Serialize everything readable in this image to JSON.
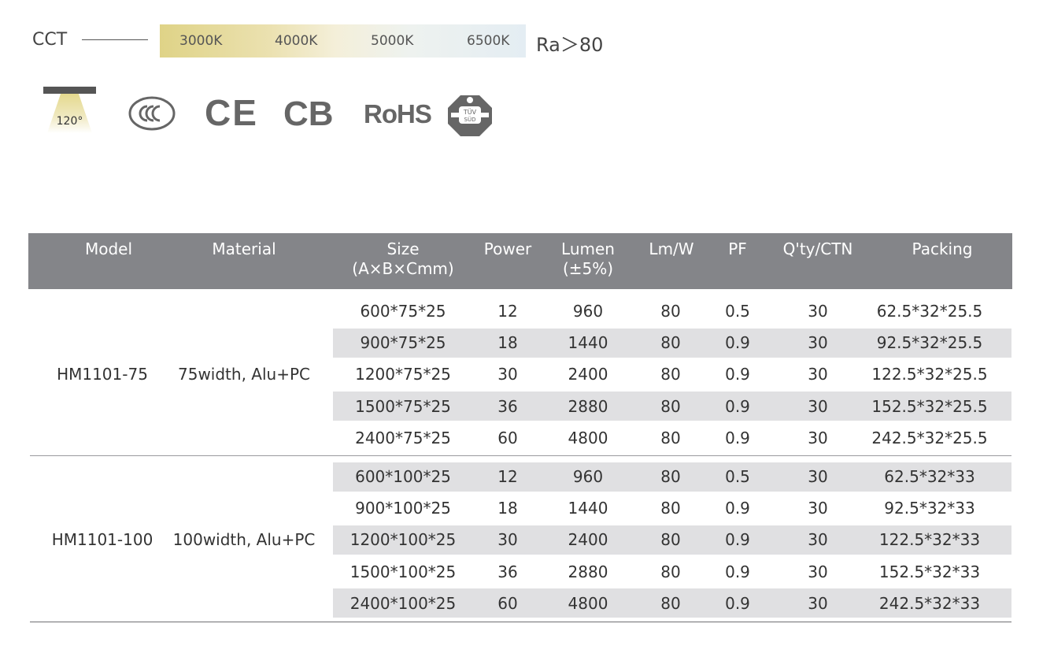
{
  "cct": {
    "label": "CCT",
    "temps": [
      "3000K",
      "4000K",
      "5000K",
      "6500K"
    ],
    "ra": "Ra＞80"
  },
  "icons": {
    "beam_angle": "120°",
    "ce": "CE",
    "cb": "CB",
    "rohs": "RoHS",
    "ccc": "CCC",
    "tuv": "TÜV SÜD"
  },
  "table": {
    "headers": [
      {
        "line1": "Model",
        "line2": ""
      },
      {
        "line1": "Material",
        "line2": ""
      },
      {
        "line1": "Size",
        "line2": "(A×B×Cmm)"
      },
      {
        "line1": "Power",
        "line2": ""
      },
      {
        "line1": "Lumen",
        "line2": "(±5%)"
      },
      {
        "line1": "Lm/W",
        "line2": ""
      },
      {
        "line1": "PF",
        "line2": ""
      },
      {
        "line1": "Q'ty/CTN",
        "line2": ""
      },
      {
        "line1": "Packing",
        "line2": ""
      }
    ],
    "groups": [
      {
        "model": "HM1101-75",
        "material": "75width, Alu+PC",
        "rows": [
          [
            "600*75*25",
            "12",
            "960",
            "80",
            "0.5",
            "30",
            "62.5*32*25.5"
          ],
          [
            "900*75*25",
            "18",
            "1440",
            "80",
            "0.9",
            "30",
            "92.5*32*25.5"
          ],
          [
            "1200*75*25",
            "30",
            "2400",
            "80",
            "0.9",
            "30",
            "122.5*32*25.5"
          ],
          [
            "1500*75*25",
            "36",
            "2880",
            "80",
            "0.9",
            "30",
            "152.5*32*25.5"
          ],
          [
            "2400*75*25",
            "60",
            "4800",
            "80",
            "0.9",
            "30",
            "242.5*32*25.5"
          ]
        ]
      },
      {
        "model": "HM1101-100",
        "material": "100width, Alu+PC",
        "rows": [
          [
            "600*100*25",
            "12",
            "960",
            "80",
            "0.5",
            "30",
            "62.5*32*33"
          ],
          [
            "900*100*25",
            "18",
            "1440",
            "80",
            "0.9",
            "30",
            "92.5*32*33"
          ],
          [
            "1200*100*25",
            "30",
            "2400",
            "80",
            "0.9",
            "30",
            "122.5*32*33"
          ],
          [
            "1500*100*25",
            "36",
            "2880",
            "80",
            "0.9",
            "30",
            "152.5*32*33"
          ],
          [
            "2400*100*25",
            "60",
            "4800",
            "80",
            "0.9",
            "30",
            "242.5*32*33"
          ]
        ]
      }
    ]
  }
}
